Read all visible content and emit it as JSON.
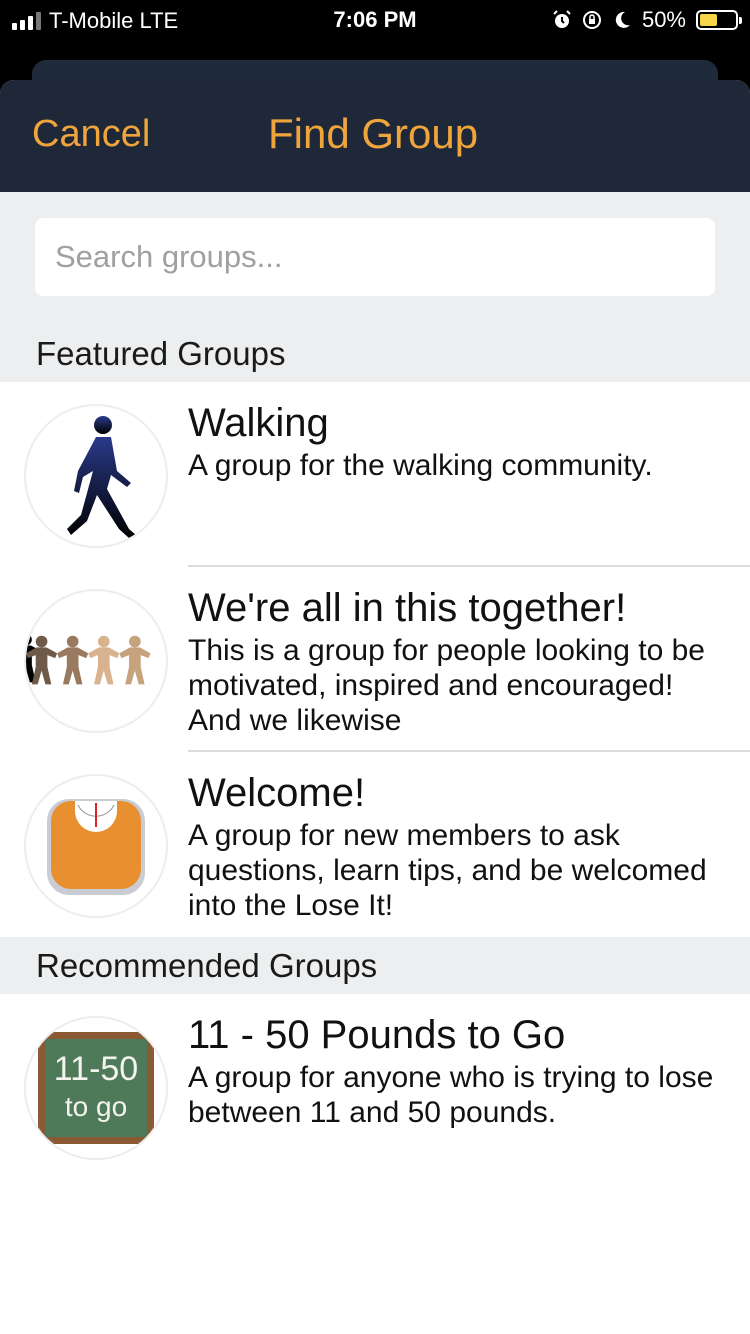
{
  "status": {
    "carrier": "T-Mobile LTE",
    "time": "7:06 PM",
    "battery": "50%",
    "battery_level": 0.5,
    "icons": [
      "alarm-icon",
      "rotation-lock-icon",
      "moon-icon"
    ]
  },
  "nav": {
    "cancel_label": "Cancel",
    "title": "Find Group"
  },
  "search": {
    "placeholder": "Search groups..."
  },
  "sections": {
    "featured": "Featured Groups",
    "recommended": "Recommended Groups"
  },
  "featured_groups": [
    {
      "title": "Walking",
      "description": "A group for the walking community.",
      "icon": "walking-person-icon"
    },
    {
      "title": "We're all in this together!",
      "description": "This is a group for people looking to be motivated, inspired and encouraged! And we likewise",
      "icon": "paper-people-chain-icon"
    },
    {
      "title": "Welcome!",
      "description": "A group for new members to ask questions, learn tips, and be welcomed into the Lose It!",
      "icon": "scale-icon"
    }
  ],
  "recommended_groups": [
    {
      "title": "11 - 50 Pounds to Go",
      "description": "A group for anyone who is trying to lose between 11 and 50 pounds.",
      "icon": "chalkboard-icon",
      "badge_line1": "11-50",
      "badge_line2": "to go"
    }
  ],
  "colors": {
    "accent": "#f0a53c",
    "nav_bg": "#1e2838",
    "section_bg": "#eceeef"
  }
}
